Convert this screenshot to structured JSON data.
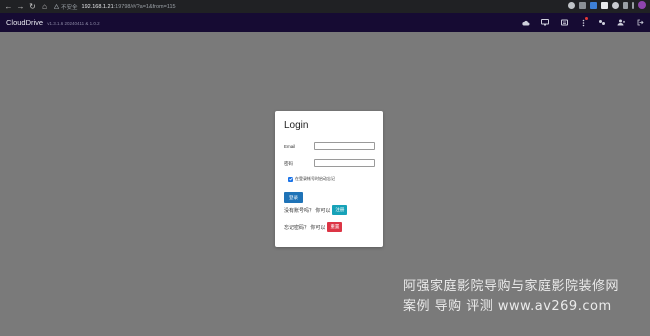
{
  "browser": {
    "security_label": "不安全",
    "url_host": "192.168.1.21",
    "url_path": ":19798/#/?a=1&from=115",
    "colors": {
      "bar": "#202124",
      "profile": "#8e44ad"
    }
  },
  "app": {
    "name": "CloudDrive",
    "version": "v1.3.1.6 20240411 & 1.0.2",
    "colors": {
      "header": "#160b33"
    },
    "header_icons": [
      "cloud-icon",
      "monitor-icon",
      "list-icon",
      "notification-icon",
      "settings-icon",
      "user-icon",
      "logout-icon"
    ]
  },
  "login": {
    "title": "Login",
    "email_label": "Email",
    "password_label": "密码",
    "email_value": "",
    "password_value": "",
    "remember_label": "在登录帐号时启动忘记",
    "login_button": "登录",
    "register_prompt": "没有账号吗？ 你可以",
    "register_button": "注册",
    "reset_prompt": "忘记密码？ 你可以",
    "reset_button": "重置",
    "colors": {
      "login": "#1f73b7",
      "register": "#17a2b8",
      "reset": "#dc3545"
    }
  },
  "watermark": {
    "line1": "阿强家庭影院导购与家庭影院装修网",
    "line2": "案例 导购 评测 www.av269.com"
  }
}
